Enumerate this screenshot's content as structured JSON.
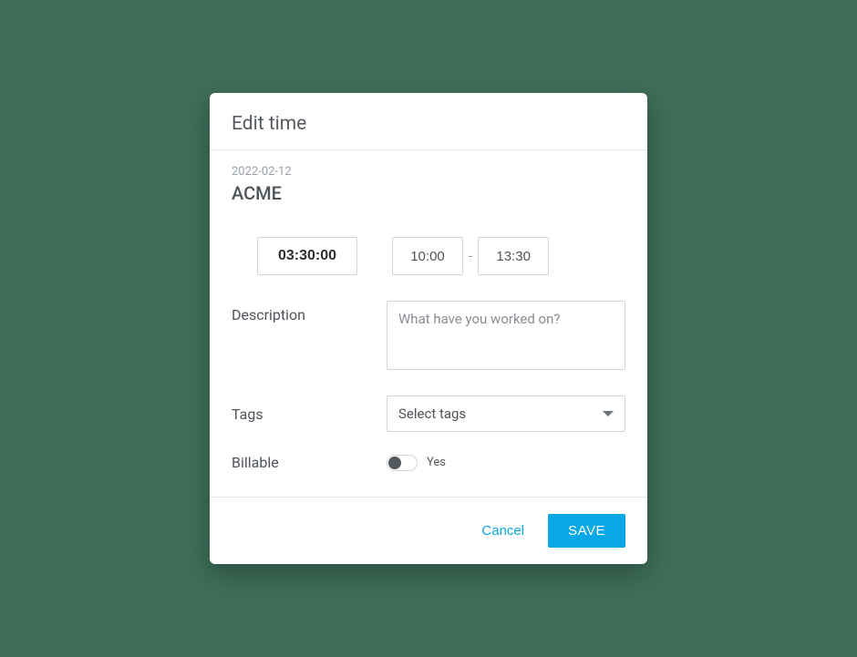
{
  "dialog": {
    "title": "Edit time",
    "date": "2022-02-12",
    "project": "ACME",
    "duration": "03:30:00",
    "start_time": "10:00",
    "end_time": "13:30",
    "time_separator": "-",
    "description": {
      "label": "Description",
      "placeholder": "What have you worked on?",
      "value": ""
    },
    "tags": {
      "label": "Tags",
      "placeholder": "Select tags"
    },
    "billable": {
      "label": "Billable",
      "value_label": "Yes",
      "on": false
    },
    "footer": {
      "cancel": "Cancel",
      "save": "SAVE"
    }
  }
}
